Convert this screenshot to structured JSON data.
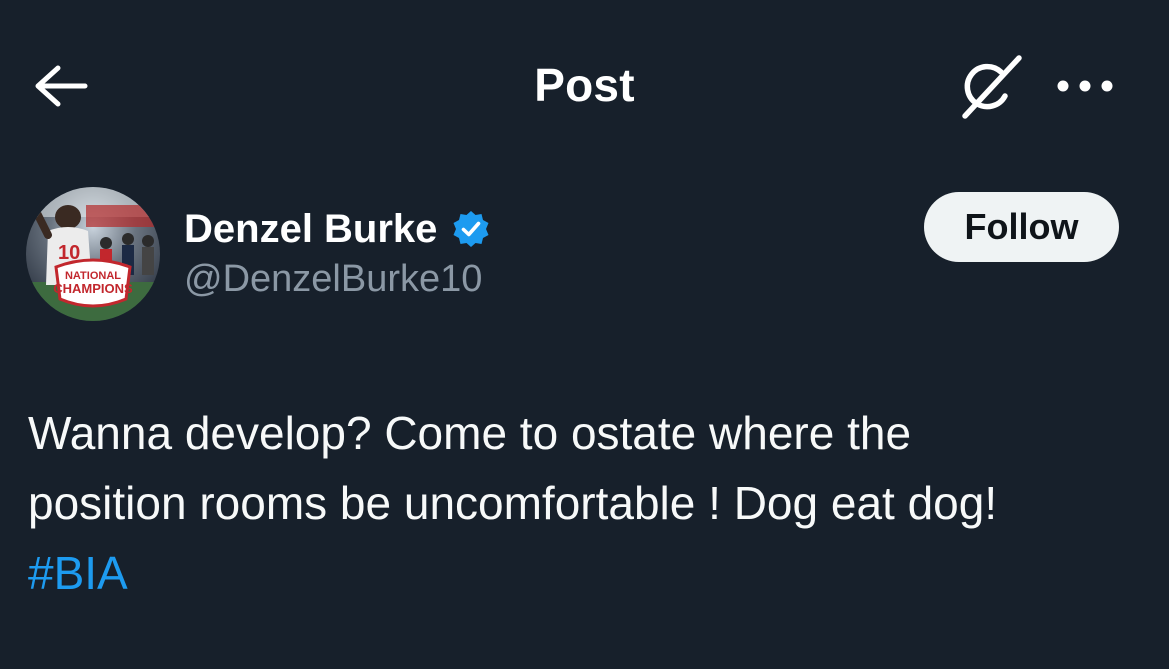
{
  "header": {
    "title": "Post",
    "back_icon": "arrow-left-icon",
    "grok_icon": "grok-icon",
    "more_icon": "more-horizontal-icon"
  },
  "author": {
    "name": "Denzel Burke",
    "handle": "@DenzelBurke10",
    "verified": true,
    "verified_color": "#1d9bf0",
    "avatar_text": "NATIONAL CHAMPIONS"
  },
  "follow_button": {
    "label": "Follow"
  },
  "tweet": {
    "line1": "Wanna develop? Come to ostate where the",
    "line2": "position rooms be uncomfortable ! Dog eat dog!",
    "hashtag": "#BIA"
  },
  "colors": {
    "background": "#17202b",
    "text": "#f7f9f9",
    "muted": "#8b98a5",
    "accent": "#1d9bf0"
  }
}
